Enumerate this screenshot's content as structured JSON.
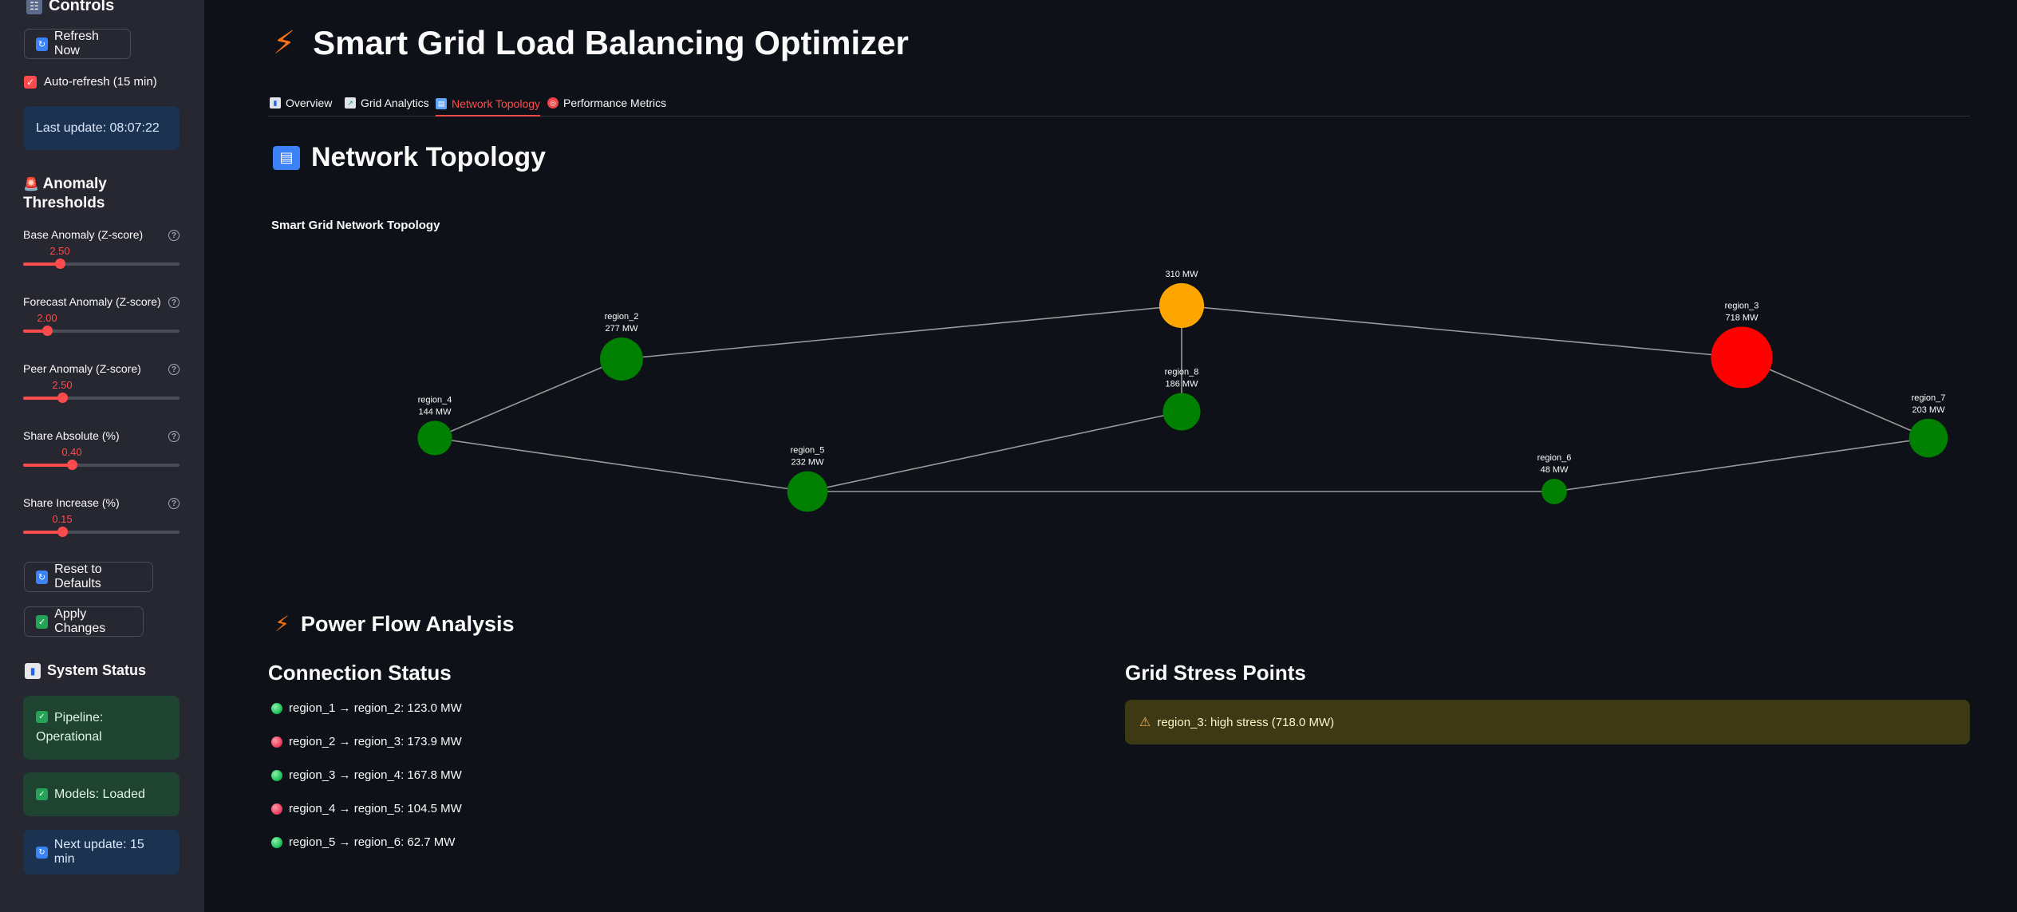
{
  "sidebar": {
    "controls_title": "Controls",
    "refresh_label": "Refresh Now",
    "auto_refresh_label": "Auto-refresh (15 min)",
    "last_update": "Last update: 08:07:22",
    "thresholds_title_line1": "Anomaly",
    "thresholds_title_line2": "Thresholds",
    "sliders": [
      {
        "label": "Base Anomaly (Z-score)",
        "value": "2.50",
        "fraction": 0.234
      },
      {
        "label": "Forecast Anomaly (Z-score)",
        "value": "2.00",
        "fraction": 0.155
      },
      {
        "label": "Peer Anomaly (Z-score)",
        "value": "2.50",
        "fraction": 0.25
      },
      {
        "label": "Share Absolute (%)",
        "value": "0.40",
        "fraction": 0.31
      },
      {
        "label": "Share Increase (%)",
        "value": "0.15",
        "fraction": 0.25
      }
    ],
    "reset_label": "Reset to Defaults",
    "apply_label": "Apply Changes",
    "status_title": "System Status",
    "pipeline_line1": "Pipeline:",
    "pipeline_line2": "Operational",
    "models": "Models: Loaded",
    "next_update": "Next update: 15 min"
  },
  "header": {
    "title": "Smart Grid Load Balancing Optimizer"
  },
  "tabs": [
    {
      "label": "Overview",
      "active": false
    },
    {
      "label": "Grid Analytics",
      "active": false
    },
    {
      "label": "Network Topology",
      "active": true
    },
    {
      "label": "Performance Metrics",
      "active": false
    }
  ],
  "topology": {
    "section_title": "Network Topology",
    "chart_title": "Smart Grid Network Topology"
  },
  "chart_data": {
    "type": "network",
    "title": "Smart Grid Network Topology",
    "nodes": [
      {
        "id": "region_1",
        "name": "",
        "mw_label": "310 MW",
        "load_mw": 310,
        "color": "#ffa500"
      },
      {
        "id": "region_2",
        "name": "region_2",
        "mw_label": "277 MW",
        "load_mw": 277,
        "color": "#008000"
      },
      {
        "id": "region_3",
        "name": "region_3",
        "mw_label": "718 MW",
        "load_mw": 718,
        "color": "#ff0000"
      },
      {
        "id": "region_4",
        "name": "region_4",
        "mw_label": "144 MW",
        "load_mw": 144,
        "color": "#008000"
      },
      {
        "id": "region_5",
        "name": "region_5",
        "mw_label": "232 MW",
        "load_mw": 232,
        "color": "#008000"
      },
      {
        "id": "region_6",
        "name": "region_6",
        "mw_label": "48 MW",
        "load_mw": 48,
        "color": "#008000"
      },
      {
        "id": "region_7",
        "name": "region_7",
        "mw_label": "203 MW",
        "load_mw": 203,
        "color": "#008000"
      },
      {
        "id": "region_8",
        "name": "region_8",
        "mw_label": "186 MW",
        "load_mw": 186,
        "color": "#008000"
      }
    ],
    "edges": [
      [
        "region_1",
        "region_2"
      ],
      [
        "region_1",
        "region_3"
      ],
      [
        "region_1",
        "region_8"
      ],
      [
        "region_2",
        "region_4"
      ],
      [
        "region_4",
        "region_5"
      ],
      [
        "region_5",
        "region_8"
      ],
      [
        "region_5",
        "region_6"
      ],
      [
        "region_6",
        "region_7"
      ],
      [
        "region_3",
        "region_7"
      ]
    ]
  },
  "power_flow": {
    "section_title": "Power Flow Analysis",
    "connection_title": "Connection Status",
    "connections": [
      {
        "text": "region_1 → region_2: 123.0 MW",
        "status": "green"
      },
      {
        "text": "region_2 → region_3: 173.9 MW",
        "status": "red"
      },
      {
        "text": "region_3 → region_4: 167.8 MW",
        "status": "green"
      },
      {
        "text": "region_4 → region_5: 104.5 MW",
        "status": "red"
      },
      {
        "text": "region_5 → region_6: 62.7 MW",
        "status": "green"
      }
    ],
    "stress_title": "Grid Stress Points",
    "stress_items": [
      "region_3: high stress (718.0 MW)"
    ]
  }
}
